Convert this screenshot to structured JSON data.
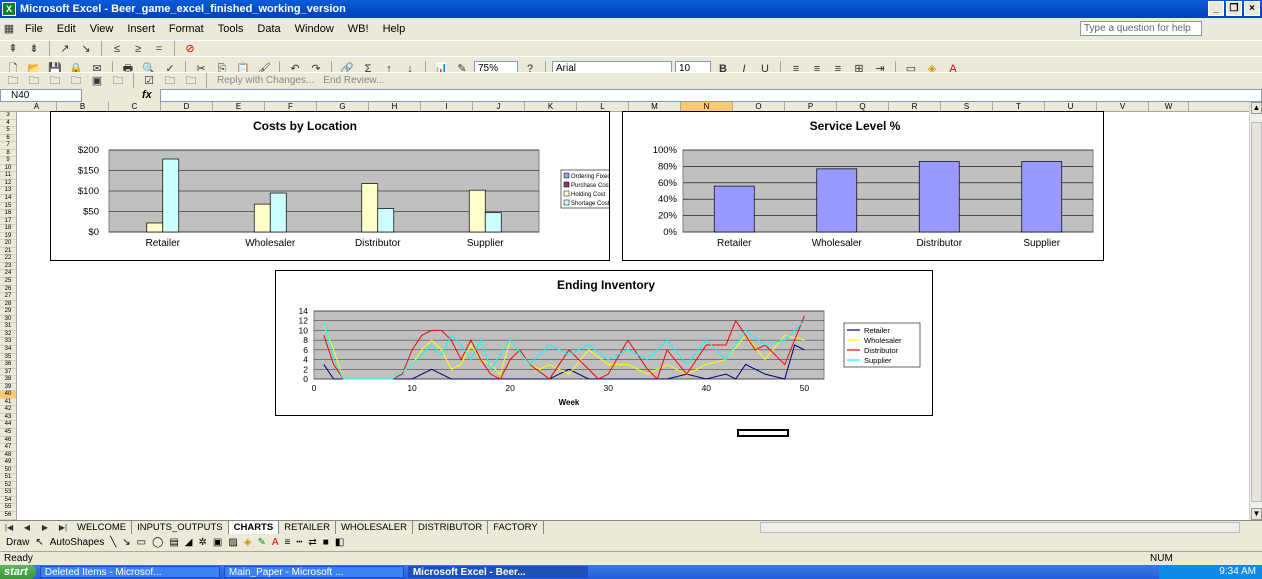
{
  "window": {
    "title": "Microsoft Excel - Beer_game_excel_finished_working_version"
  },
  "menu": [
    "File",
    "Edit",
    "View",
    "Insert",
    "Format",
    "Tools",
    "Data",
    "Window",
    "WB!",
    "Help"
  ],
  "help_placeholder": "Type a question for help",
  "toolbar": {
    "zoom": "75%",
    "font": "Arial",
    "font_size": "10",
    "reply_label": "Reply with Changes...",
    "end_review_label": "End Review..."
  },
  "formula_bar": {
    "name_box": "N40",
    "fx": "fx"
  },
  "columns": [
    "A",
    "B",
    "C",
    "D",
    "E",
    "F",
    "G",
    "H",
    "I",
    "J",
    "K",
    "L",
    "M",
    "N",
    "O",
    "P",
    "Q",
    "R",
    "S",
    "T",
    "U",
    "V",
    "W"
  ],
  "rows_start": 3,
  "rows_end": 56,
  "chart_data": [
    {
      "type": "bar",
      "title": "Costs by Location",
      "categories": [
        "Retailer",
        "Wholesaler",
        "Distributor",
        "Supplier"
      ],
      "yticks": [
        "$0",
        "$50",
        "$100",
        "$150",
        "$200"
      ],
      "ylim": [
        0,
        200
      ],
      "legend_position": "right",
      "series": [
        {
          "name": "Ordering Fixed Cost",
          "values": [
            0,
            0,
            0,
            0
          ],
          "color": "#9999ff"
        },
        {
          "name": "Purchase Cost",
          "values": [
            0,
            0,
            0,
            0
          ],
          "color": "#993366"
        },
        {
          "name": "Holding Cost",
          "values": [
            22,
            68,
            118,
            102
          ],
          "color": "#ffffcc"
        },
        {
          "name": "Shortage Cost",
          "values": [
            178,
            95,
            57,
            47
          ],
          "color": "#ccffff"
        }
      ]
    },
    {
      "type": "bar",
      "title": "Service Level %",
      "categories": [
        "Retailer",
        "Wholesaler",
        "Distributor",
        "Supplier"
      ],
      "yticks": [
        "0%",
        "20%",
        "40%",
        "60%",
        "80%",
        "100%"
      ],
      "ylim": [
        0,
        100
      ],
      "series": [
        {
          "name": "",
          "values": [
            56,
            77,
            86,
            86
          ],
          "color": "#9999ff"
        }
      ]
    },
    {
      "type": "line",
      "title": "Ending Inventory",
      "xlabel": "Week",
      "xticks": [
        "0",
        "10",
        "20",
        "30",
        "40",
        "50"
      ],
      "yticks": [
        "0",
        "2",
        "4",
        "6",
        "8",
        "10",
        "12",
        "14"
      ],
      "xlim": [
        0,
        52
      ],
      "ylim": [
        0,
        14
      ],
      "legend_position": "right",
      "series": [
        {
          "name": "Retailer",
          "color": "#000080",
          "x": [
            1,
            2,
            3,
            4,
            6,
            8,
            10,
            12,
            13,
            14,
            16,
            18,
            20,
            22,
            24,
            26,
            28,
            30,
            32,
            34,
            36,
            38,
            40,
            42,
            43,
            44,
            46,
            48,
            49,
            50
          ],
          "y": [
            3,
            0,
            0,
            0,
            0,
            0,
            0,
            2,
            1,
            0,
            0,
            0,
            0,
            0,
            0,
            2,
            0,
            0,
            0,
            0,
            0,
            1,
            0,
            1,
            0,
            3,
            1,
            0,
            7,
            6
          ]
        },
        {
          "name": "Wholesaler",
          "color": "#ffff00",
          "x": [
            1,
            2,
            3,
            4,
            6,
            8,
            10,
            11,
            12,
            13,
            14,
            15,
            16,
            17,
            18,
            19,
            20,
            22,
            23,
            24,
            26,
            28,
            30,
            32,
            34,
            36,
            38,
            40,
            42,
            44,
            46,
            48,
            50
          ],
          "y": [
            11,
            6,
            0,
            0,
            0,
            0,
            3,
            6,
            8,
            6,
            2,
            3,
            7,
            4,
            3,
            1,
            8,
            3,
            2,
            3,
            1,
            6,
            3,
            3,
            1,
            3,
            1,
            3,
            4,
            9,
            4,
            9,
            8
          ]
        },
        {
          "name": "Distributor",
          "color": "#ff0000",
          "x": [
            1,
            2,
            3,
            4,
            6,
            8,
            9,
            10,
            11,
            12,
            13,
            14,
            15,
            16,
            17,
            18,
            19,
            20,
            21,
            22,
            24,
            25,
            26,
            28,
            29,
            30,
            32,
            34,
            35,
            36,
            38,
            40,
            42,
            43,
            44,
            45,
            46,
            48,
            50
          ],
          "y": [
            9,
            3,
            0,
            0,
            0,
            0,
            1,
            6,
            9,
            10,
            10,
            8,
            4,
            8,
            4,
            1,
            0,
            4,
            6,
            3,
            0,
            3,
            6,
            2,
            0,
            1,
            8,
            2,
            0,
            6,
            1,
            7,
            7,
            12,
            9,
            6,
            7,
            3,
            13
          ]
        },
        {
          "name": "Supplier",
          "color": "#00ffff",
          "x": [
            1,
            2,
            3,
            4,
            6,
            8,
            10,
            12,
            13,
            14,
            15,
            16,
            17,
            18,
            19,
            20,
            22,
            24,
            26,
            28,
            30,
            32,
            34,
            36,
            38,
            40,
            42,
            44,
            46,
            48,
            50
          ],
          "y": [
            12,
            4,
            0,
            0,
            0,
            0,
            3,
            7,
            5,
            9,
            7,
            4,
            8,
            2,
            5,
            8,
            3,
            7,
            5,
            7,
            4,
            6,
            4,
            8,
            3,
            8,
            4,
            10,
            7,
            8,
            12
          ]
        }
      ]
    }
  ],
  "sheet_tabs": [
    "WELCOME",
    "INPUTS_OUTPUTS",
    "CHARTS",
    "RETAILER",
    "WHOLESALER",
    "DISTRIBUTOR",
    "FACTORY"
  ],
  "active_tab": "CHARTS",
  "draw_toolbar": {
    "draw": "Draw",
    "autoshapes": "AutoShapes"
  },
  "status": {
    "left": "Ready",
    "right": "NUM"
  },
  "taskbar": {
    "start": "start",
    "tasks": [
      "Deleted Items - Microsof...",
      "Main_Paper - Microsoft ...",
      "Microsoft Excel - Beer..."
    ],
    "time": "9:34 AM"
  }
}
